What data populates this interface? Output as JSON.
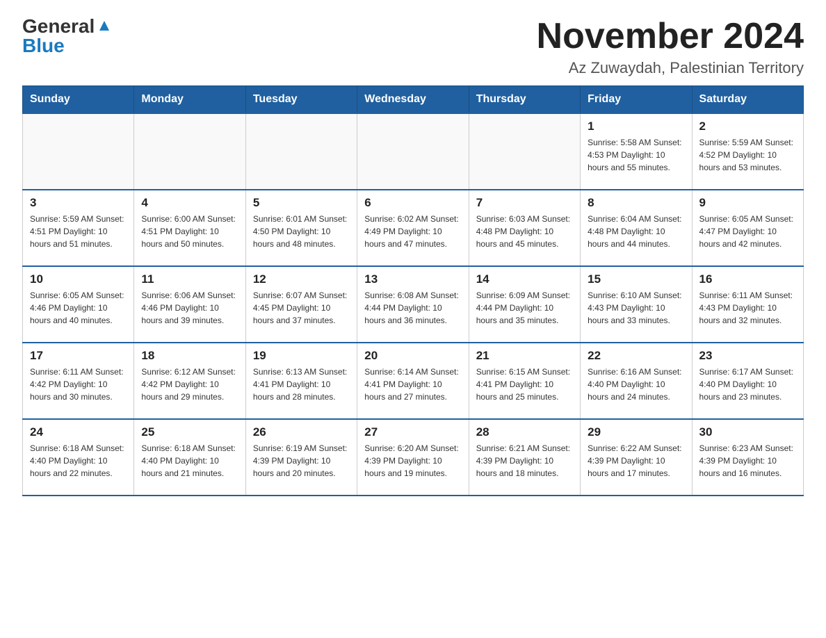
{
  "logo": {
    "general": "General",
    "blue": "Blue"
  },
  "header": {
    "month_year": "November 2024",
    "location": "Az Zuwaydah, Palestinian Territory"
  },
  "weekdays": [
    "Sunday",
    "Monday",
    "Tuesday",
    "Wednesday",
    "Thursday",
    "Friday",
    "Saturday"
  ],
  "weeks": [
    [
      {
        "day": "",
        "info": ""
      },
      {
        "day": "",
        "info": ""
      },
      {
        "day": "",
        "info": ""
      },
      {
        "day": "",
        "info": ""
      },
      {
        "day": "",
        "info": ""
      },
      {
        "day": "1",
        "info": "Sunrise: 5:58 AM\nSunset: 4:53 PM\nDaylight: 10 hours and 55 minutes."
      },
      {
        "day": "2",
        "info": "Sunrise: 5:59 AM\nSunset: 4:52 PM\nDaylight: 10 hours and 53 minutes."
      }
    ],
    [
      {
        "day": "3",
        "info": "Sunrise: 5:59 AM\nSunset: 4:51 PM\nDaylight: 10 hours and 51 minutes."
      },
      {
        "day": "4",
        "info": "Sunrise: 6:00 AM\nSunset: 4:51 PM\nDaylight: 10 hours and 50 minutes."
      },
      {
        "day": "5",
        "info": "Sunrise: 6:01 AM\nSunset: 4:50 PM\nDaylight: 10 hours and 48 minutes."
      },
      {
        "day": "6",
        "info": "Sunrise: 6:02 AM\nSunset: 4:49 PM\nDaylight: 10 hours and 47 minutes."
      },
      {
        "day": "7",
        "info": "Sunrise: 6:03 AM\nSunset: 4:48 PM\nDaylight: 10 hours and 45 minutes."
      },
      {
        "day": "8",
        "info": "Sunrise: 6:04 AM\nSunset: 4:48 PM\nDaylight: 10 hours and 44 minutes."
      },
      {
        "day": "9",
        "info": "Sunrise: 6:05 AM\nSunset: 4:47 PM\nDaylight: 10 hours and 42 minutes."
      }
    ],
    [
      {
        "day": "10",
        "info": "Sunrise: 6:05 AM\nSunset: 4:46 PM\nDaylight: 10 hours and 40 minutes."
      },
      {
        "day": "11",
        "info": "Sunrise: 6:06 AM\nSunset: 4:46 PM\nDaylight: 10 hours and 39 minutes."
      },
      {
        "day": "12",
        "info": "Sunrise: 6:07 AM\nSunset: 4:45 PM\nDaylight: 10 hours and 37 minutes."
      },
      {
        "day": "13",
        "info": "Sunrise: 6:08 AM\nSunset: 4:44 PM\nDaylight: 10 hours and 36 minutes."
      },
      {
        "day": "14",
        "info": "Sunrise: 6:09 AM\nSunset: 4:44 PM\nDaylight: 10 hours and 35 minutes."
      },
      {
        "day": "15",
        "info": "Sunrise: 6:10 AM\nSunset: 4:43 PM\nDaylight: 10 hours and 33 minutes."
      },
      {
        "day": "16",
        "info": "Sunrise: 6:11 AM\nSunset: 4:43 PM\nDaylight: 10 hours and 32 minutes."
      }
    ],
    [
      {
        "day": "17",
        "info": "Sunrise: 6:11 AM\nSunset: 4:42 PM\nDaylight: 10 hours and 30 minutes."
      },
      {
        "day": "18",
        "info": "Sunrise: 6:12 AM\nSunset: 4:42 PM\nDaylight: 10 hours and 29 minutes."
      },
      {
        "day": "19",
        "info": "Sunrise: 6:13 AM\nSunset: 4:41 PM\nDaylight: 10 hours and 28 minutes."
      },
      {
        "day": "20",
        "info": "Sunrise: 6:14 AM\nSunset: 4:41 PM\nDaylight: 10 hours and 27 minutes."
      },
      {
        "day": "21",
        "info": "Sunrise: 6:15 AM\nSunset: 4:41 PM\nDaylight: 10 hours and 25 minutes."
      },
      {
        "day": "22",
        "info": "Sunrise: 6:16 AM\nSunset: 4:40 PM\nDaylight: 10 hours and 24 minutes."
      },
      {
        "day": "23",
        "info": "Sunrise: 6:17 AM\nSunset: 4:40 PM\nDaylight: 10 hours and 23 minutes."
      }
    ],
    [
      {
        "day": "24",
        "info": "Sunrise: 6:18 AM\nSunset: 4:40 PM\nDaylight: 10 hours and 22 minutes."
      },
      {
        "day": "25",
        "info": "Sunrise: 6:18 AM\nSunset: 4:40 PM\nDaylight: 10 hours and 21 minutes."
      },
      {
        "day": "26",
        "info": "Sunrise: 6:19 AM\nSunset: 4:39 PM\nDaylight: 10 hours and 20 minutes."
      },
      {
        "day": "27",
        "info": "Sunrise: 6:20 AM\nSunset: 4:39 PM\nDaylight: 10 hours and 19 minutes."
      },
      {
        "day": "28",
        "info": "Sunrise: 6:21 AM\nSunset: 4:39 PM\nDaylight: 10 hours and 18 minutes."
      },
      {
        "day": "29",
        "info": "Sunrise: 6:22 AM\nSunset: 4:39 PM\nDaylight: 10 hours and 17 minutes."
      },
      {
        "day": "30",
        "info": "Sunrise: 6:23 AM\nSunset: 4:39 PM\nDaylight: 10 hours and 16 minutes."
      }
    ]
  ]
}
